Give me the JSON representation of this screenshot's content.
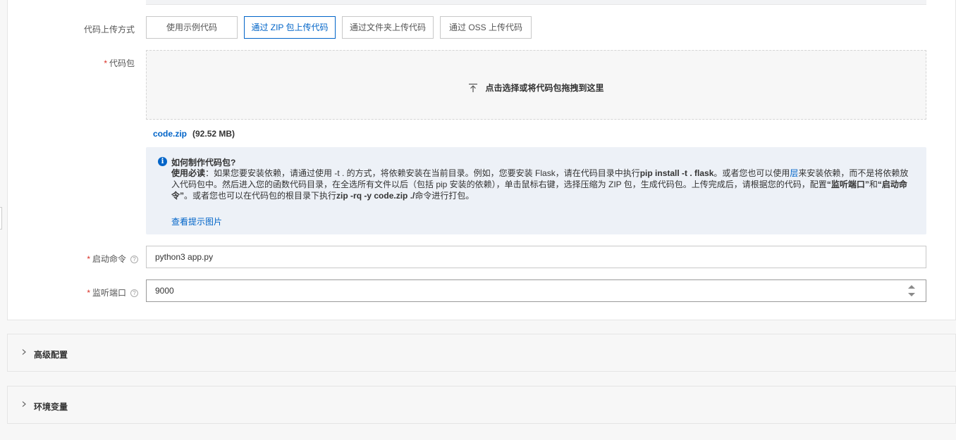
{
  "form": {
    "upload_method": {
      "label": "代码上传方式",
      "options": [
        "使用示例代码",
        "通过 ZIP 包上传代码",
        "通过文件夹上传代码",
        "通过 OSS 上传代码"
      ],
      "selected": "通过 ZIP 包上传代码"
    },
    "code_package": {
      "required_mark": "*",
      "label": "代码包",
      "dropzone_text": "点击选择或将代码包拖拽到这里",
      "file_name": "code.zip",
      "file_size": "(92.52 MB)"
    },
    "tip": {
      "title": "如何制作代码包?",
      "body_lead": "使用必读",
      "body_1": "：如果您要安装依赖，请通过使用 -t . 的方式，将依赖安装在当前目录。例如，您要安装 Flask，请在代码目录中执行",
      "cmd_1": "pip install -t . flask",
      "body_2": "。或者您也可以使用",
      "layer_link": "层",
      "body_3": "来安装依赖，而不是将依赖放入代码包中。然后进入您的函数代码目录，在全选所有文件以后（包括 pip 安装的依赖），单击鼠标右键，选择压缩为 ZIP 包，生成代码包。上传完成后，请根据您的代码，配置",
      "cfg_port": "“监听端口”",
      "body_4": "和",
      "cfg_cmd": "“启动命令”",
      "body_5": "。或者您也可以在代码包的根目录下执行",
      "cmd_2": "zip -rq -y code.zip ./",
      "body_6": "命令进行打包。",
      "link": "查看提示图片"
    },
    "start_command": {
      "required_mark": "*",
      "label": "启动命令",
      "value": "python3 app.py",
      "help_icon": "question-circle-icon"
    },
    "listen_port": {
      "required_mark": "*",
      "label": "监听端口",
      "value": "9000",
      "help_icon": "question-circle-icon"
    }
  },
  "panels": [
    {
      "title": "高级配置",
      "icon": "chevron-right-icon"
    },
    {
      "title": "环境变量",
      "icon": "chevron-right-icon"
    }
  ],
  "colors": {
    "accent": "#0064c8",
    "required": "#d93026",
    "tip_bg": "#edf1f7"
  }
}
